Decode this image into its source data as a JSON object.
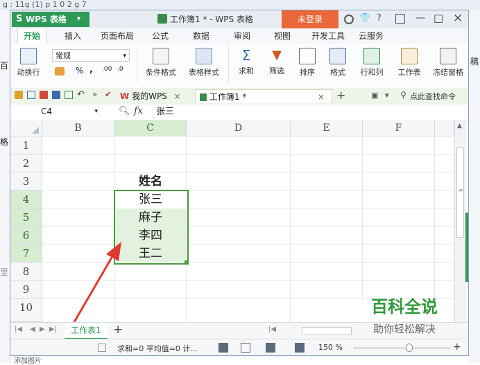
{
  "background": {
    "left_fragment_1": "百",
    "left_fragment_2": "格",
    "left_fragment_3": "里",
    "left_fragment_4": "添加图片",
    "right_fragment": "稿",
    "top_fragment": "g : 11g (1)  p  1  0  2  g  7"
  },
  "titlebar": {
    "app_label": "WPS 表格",
    "doc_title": "工作簿1 * - WPS 表格",
    "login_label": "未登录",
    "help_label": "?",
    "minimize_icon": "—",
    "maximize_icon": "□",
    "close_icon": "×"
  },
  "menubar": {
    "items": [
      "开始",
      "插入",
      "页面布局",
      "公式",
      "数据",
      "审阅",
      "视图",
      "开发工具",
      "云服务"
    ]
  },
  "ribbon": {
    "wrap_label": "动换行",
    "number_format": "常规",
    "percent": "%",
    "comma": ",",
    "dec_inc": ".00",
    "dec_dec": ".0",
    "cond_format": "条件格式",
    "table_style": "表格样式",
    "sum": "求和",
    "filter": "筛选",
    "sort": "排序",
    "format": "格式",
    "row_col": "行和列",
    "worksheet": "工作表",
    "freeze": "冻结窗格"
  },
  "qa": {
    "tab_mywps": "我的WPS",
    "tab_workbook": "工作簿1 *",
    "add_tab": "+",
    "search_cmd": "点此查找命令"
  },
  "formula_bar": {
    "cell_ref": "C4",
    "fx": "fx",
    "content": "张三"
  },
  "columns": [
    "B",
    "C",
    "D",
    "E",
    "F"
  ],
  "rows": [
    "1",
    "2",
    "3",
    "4",
    "5",
    "6",
    "7",
    "8",
    "9",
    "10"
  ],
  "cells": {
    "header": "姓名",
    "names": [
      "张三",
      "麻子",
      "李四",
      "王二"
    ]
  },
  "sheet_tabs": {
    "active": "工作表1",
    "add": "+"
  },
  "status": {
    "text": "求和=0  平均值=0  计...",
    "zoom": "150 %"
  },
  "watermark": {
    "title": "百科全说",
    "subtitle": "助你轻松解决"
  },
  "colors": {
    "accent_green": "#2e9a58",
    "login_orange": "#e8683a",
    "selection_border": "#4a9a3a",
    "selection_fill": "#e3f2de",
    "arrow_red": "#e03a2f"
  }
}
